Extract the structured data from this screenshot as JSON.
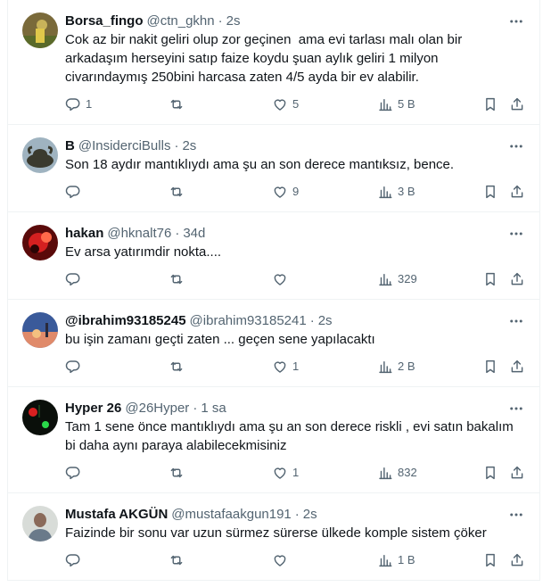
{
  "tweets": [
    {
      "name": "Borsa_fingo",
      "handle": "@ctn_gkhn",
      "time": "2s",
      "text": "Cok az bir nakit geliri olup zor geçinen  ama evi tarlası malı olan bir arkadaşım herseyini satıp faize koydu şuan aylık geliri 1 milyon civarındaymış 250bini harcasa zaten 4/5 ayda bir ev alabilir.",
      "replies": "1",
      "retweets": "",
      "likes": "5",
      "views": "5 B",
      "avatar_icon": "borsa-fingo-avatar",
      "avatar_colors": [
        "#7a6a3a",
        "#c8b35a"
      ]
    },
    {
      "name": "B",
      "handle": "@InsiderciBulls",
      "time": "2s",
      "text": "Son 18 aydır mantıklıydı ama şu an son derece mantıksız, bence.",
      "replies": "",
      "retweets": "",
      "likes": "9",
      "views": "3 B",
      "avatar_icon": "bull-statue-avatar",
      "avatar_colors": [
        "#9fb3c0",
        "#3a3a2e"
      ]
    },
    {
      "name": "hakan",
      "handle": "@hknalt76",
      "time": "34d",
      "text": "Ev arsa yatırımdir nokta....",
      "replies": "",
      "retweets": "",
      "likes": "",
      "views": "329",
      "avatar_icon": "red-abstract-avatar",
      "avatar_colors": [
        "#5a0a0a",
        "#d42020"
      ]
    },
    {
      "name": "@ibrahim93185245",
      "handle": "@ibrahim93185241",
      "time": "2s",
      "text": "bu işin zamanı geçti zaten ... geçen sene yapılacaktı",
      "replies": "",
      "retweets": "",
      "likes": "1",
      "views": "2 B",
      "avatar_icon": "sunset-sky-avatar",
      "avatar_colors": [
        "#3a5a9a",
        "#e08a6a"
      ]
    },
    {
      "name": "Hyper 26",
      "handle": "@26Hyper",
      "time": "1 sa",
      "text": "Tam 1 sene önce mantıklıydı ama şu an son derece riskli , evi satın bakalım bi daha aynı paraya alabilecekmisiniz",
      "replies": "",
      "retweets": "",
      "likes": "1",
      "views": "832",
      "avatar_icon": "dark-neon-avatar",
      "avatar_colors": [
        "#0a0f0a",
        "#2ad84a"
      ]
    },
    {
      "name": "Mustafa AKGÜN",
      "handle": "@mustafaakgun191",
      "time": "2s",
      "text": "Faizinde bir sonu var uzun sürmez sürerse ülkede komple sistem çöker",
      "replies": "",
      "retweets": "",
      "likes": "",
      "views": "1 B",
      "avatar_icon": "person-photo-avatar",
      "avatar_colors": [
        "#d8dcd8",
        "#8a6a5a"
      ]
    }
  ]
}
